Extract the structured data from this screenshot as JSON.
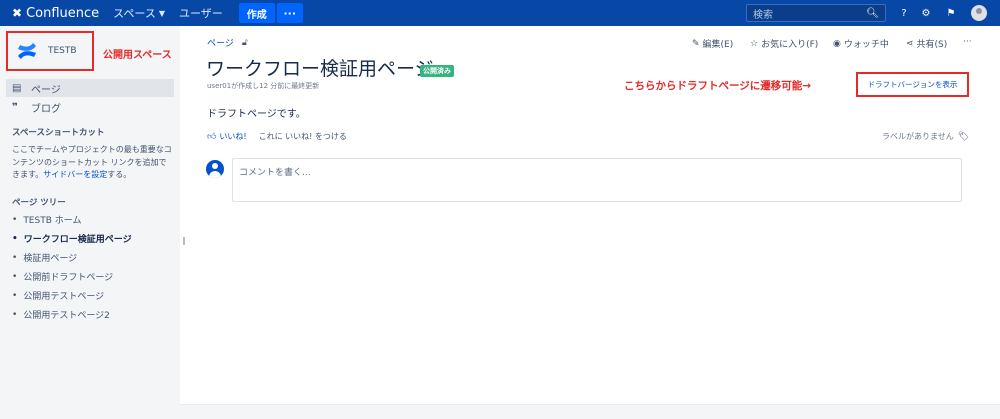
{
  "topbar": {
    "app_name": "Confluence",
    "nav": [
      {
        "label": "スペース"
      },
      {
        "label": "ユーザー"
      }
    ],
    "create_label": "作成",
    "more_label": "···",
    "search_placeholder": "検索",
    "colors": {
      "bar": "#0747a6",
      "create": "#0065ff"
    }
  },
  "sidebar": {
    "space_name": "TESTB",
    "annotation_public": "公開用スペース",
    "nav_items": [
      {
        "label": "ページ",
        "icon": "page-icon"
      },
      {
        "label": "ブログ",
        "icon": "quote-icon"
      }
    ],
    "shortcut_title": "スペースショートカット",
    "shortcut_text_pre": "ここでチームやプロジェクトの最も重要なコンテンツのショートカット リンクを追加できます。",
    "shortcut_link": "サイドバーを設定",
    "shortcut_text_post": "する。",
    "tree_title": "ページ ツリー",
    "tree": [
      {
        "label": "TESTB ホーム"
      },
      {
        "label": "ワークフロー検証用ページ",
        "current": true
      },
      {
        "label": "検証用ページ"
      },
      {
        "label": "公開前ドラフトページ"
      },
      {
        "label": "公開用テストページ"
      },
      {
        "label": "公開用テストページ2"
      }
    ]
  },
  "main": {
    "breadcrumb": "ページ",
    "actions": {
      "edit": "編集(E)",
      "favorite": "お気に入り(F)",
      "watch": "ウォッチ中",
      "share": "共有(S)",
      "more": "···"
    },
    "title": "ワークフロー検証用ページ",
    "status_badge": "公開済み",
    "byline": "user01が作成し12 分前に最終更新",
    "annotation_draft": "こちらからドラフトページに遷移可能→",
    "draft_button": "ドラフトバージョンを表示",
    "body": "ドラフトページです。",
    "like_label": "いいね!",
    "like_sub": "これに いいね! をつける",
    "no_labels": "ラベルがありません",
    "comment_placeholder": "コメントを書く..."
  }
}
